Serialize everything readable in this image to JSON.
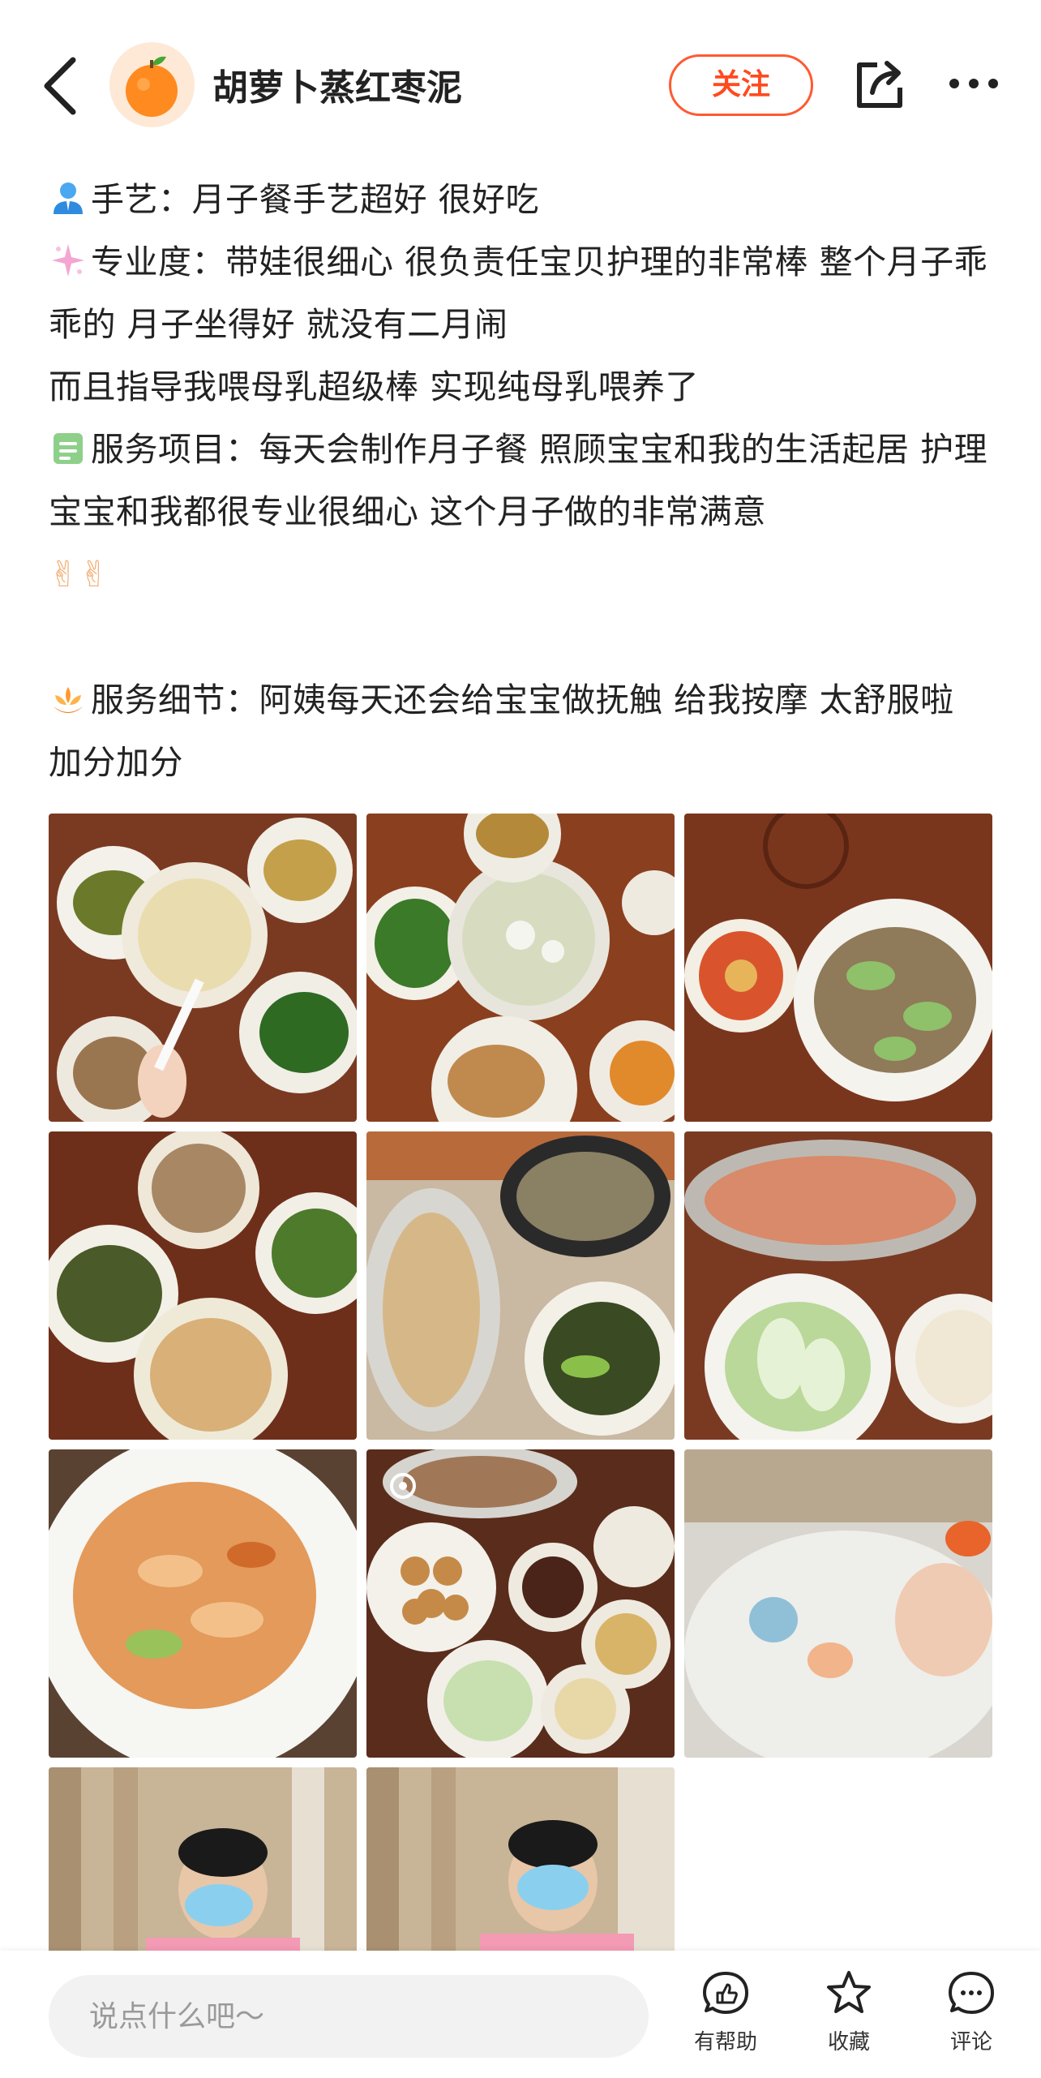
{
  "header": {
    "author_name": "胡萝卜蒸红枣泥",
    "follow_label": "关注",
    "icons": [
      "back-icon",
      "avatar-orange-icon",
      "share-icon",
      "more-icon"
    ]
  },
  "post": {
    "paragraphs": [
      {
        "emoji": "person-icon",
        "text": "手艺：月子餐手艺超好 很好吃"
      },
      {
        "emoji": "sparkle-icon",
        "text": "专业度：带娃很细心 很负责任宝贝护理的非常棒 整个月子乖乖的 月子坐得好 就没有二月闹"
      },
      {
        "emoji": null,
        "text": "而且指导我喂母乳超级棒 实现纯母乳喂养了"
      },
      {
        "emoji": "memo-icon",
        "text": "服务项目：每天会制作月子餐 照顾宝宝和我的生活起居 护理宝宝和我都很专业很细心 这个月子做的非常满意"
      },
      {
        "emoji": null,
        "text": "✌✌"
      },
      {
        "emoji": null,
        "text": ""
      },
      {
        "emoji": "lotus-hands-icon",
        "text": "服务细节：阿姨每天还会给宝宝做抚触 给我按摩 太舒服啦 加分加分"
      }
    ]
  },
  "photos": [
    {
      "name": "photo-meal-soup-greens"
    },
    {
      "name": "photo-fish-soup-chicken"
    },
    {
      "name": "photo-beef-zucchini"
    },
    {
      "name": "photo-tofu-greens"
    },
    {
      "name": "photo-steamed-fish-pot"
    },
    {
      "name": "photo-shrimp-bokchoy"
    },
    {
      "name": "photo-stir-fry-shrimp"
    },
    {
      "name": "photo-meatballs-spread"
    },
    {
      "name": "photo-sleeping-baby"
    },
    {
      "name": "photo-nanny-1"
    },
    {
      "name": "photo-nanny-2"
    }
  ],
  "bottom_bar": {
    "comment_placeholder": "说点什么吧～",
    "helpful_label": "有帮助",
    "collect_label": "收藏",
    "comment_label": "评论"
  },
  "colors": {
    "accent": "#ff4a1f",
    "text": "#222222",
    "input_bg": "#f2f2f2"
  }
}
